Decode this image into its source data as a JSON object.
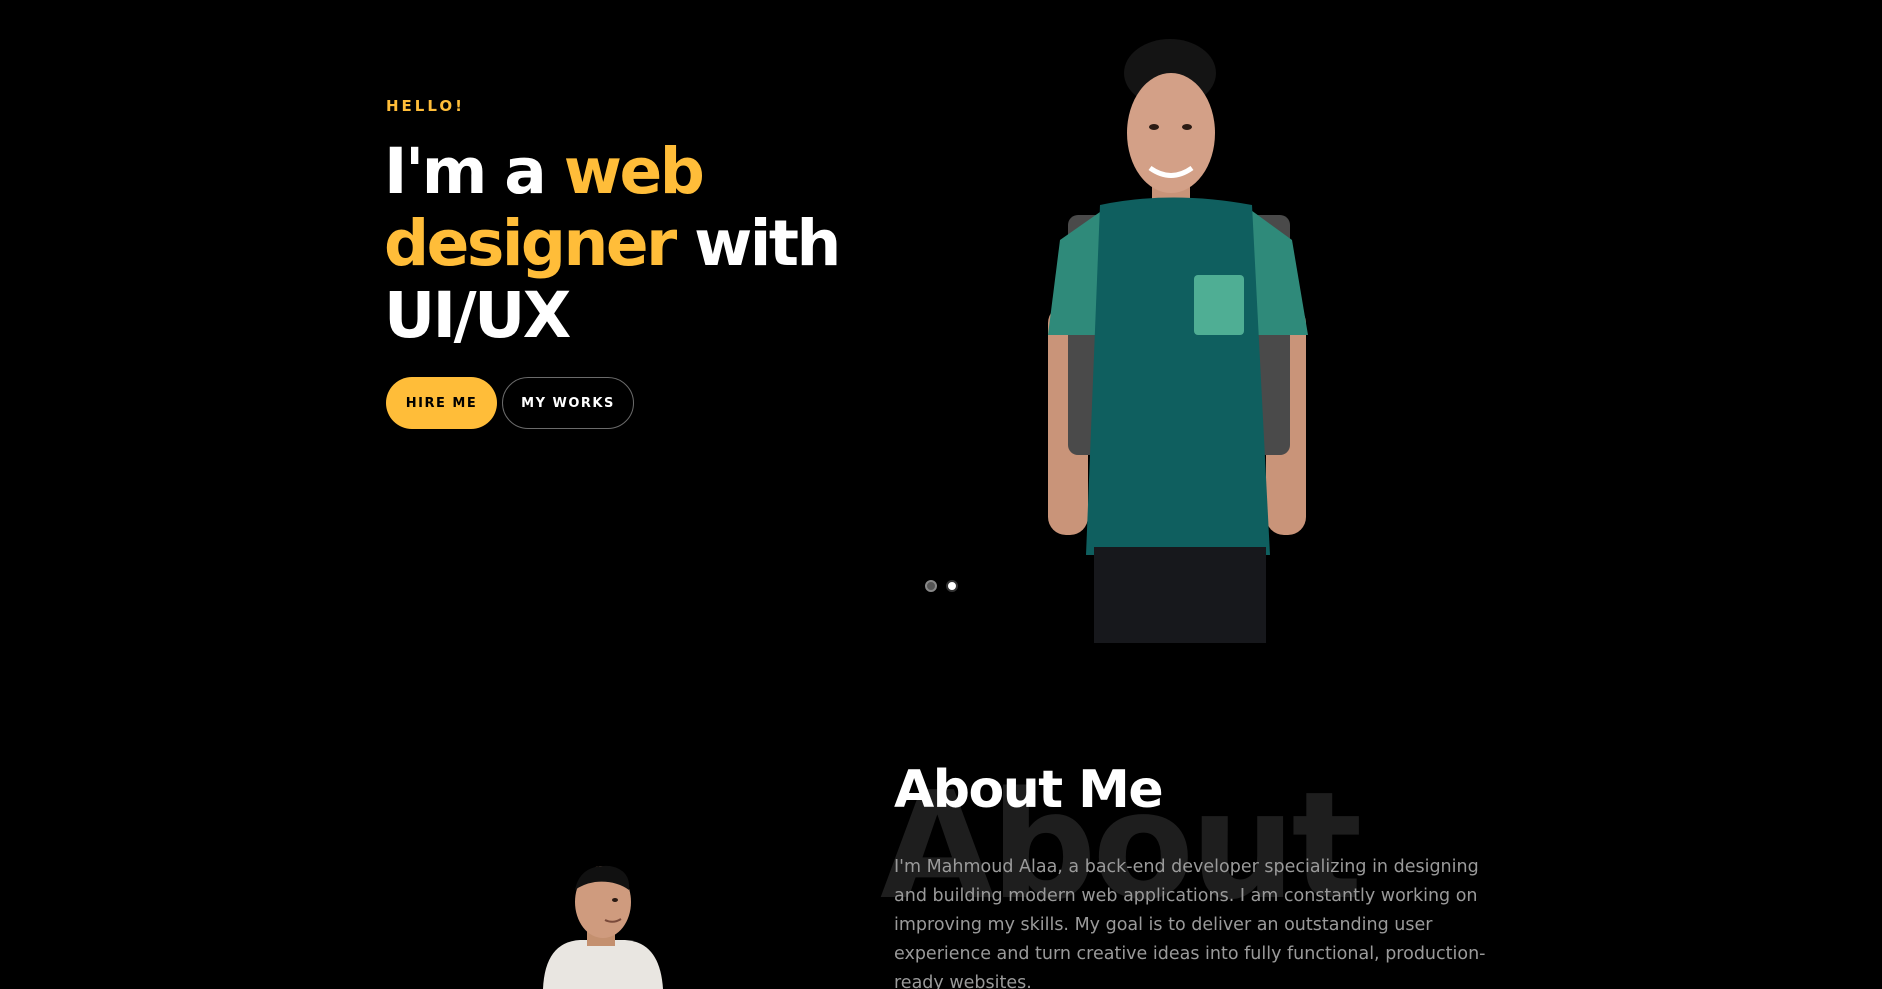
{
  "hero": {
    "greeting": "HELLO!",
    "heading": {
      "part1": "I'm a ",
      "accent": "web designer",
      "part2": " with UI/UX"
    },
    "buttons": {
      "hire": "HIRE ME",
      "works": "MY WORKS"
    },
    "slider": {
      "dots": 2,
      "active_index": 1
    }
  },
  "about": {
    "title": "About Me",
    "background_word": "About",
    "text": "I'm Mahmoud Alaa, a back-end developer specializing in designing and building modern web applications. I am constantly working on improving my skills. My goal is to deliver an outstanding user experience and turn creative ideas into fully functional, production-ready websites."
  },
  "colors": {
    "background": "#000000",
    "accent": "#ffbd39",
    "text_primary": "#ffffff",
    "text_muted": "#9a9a9a"
  }
}
